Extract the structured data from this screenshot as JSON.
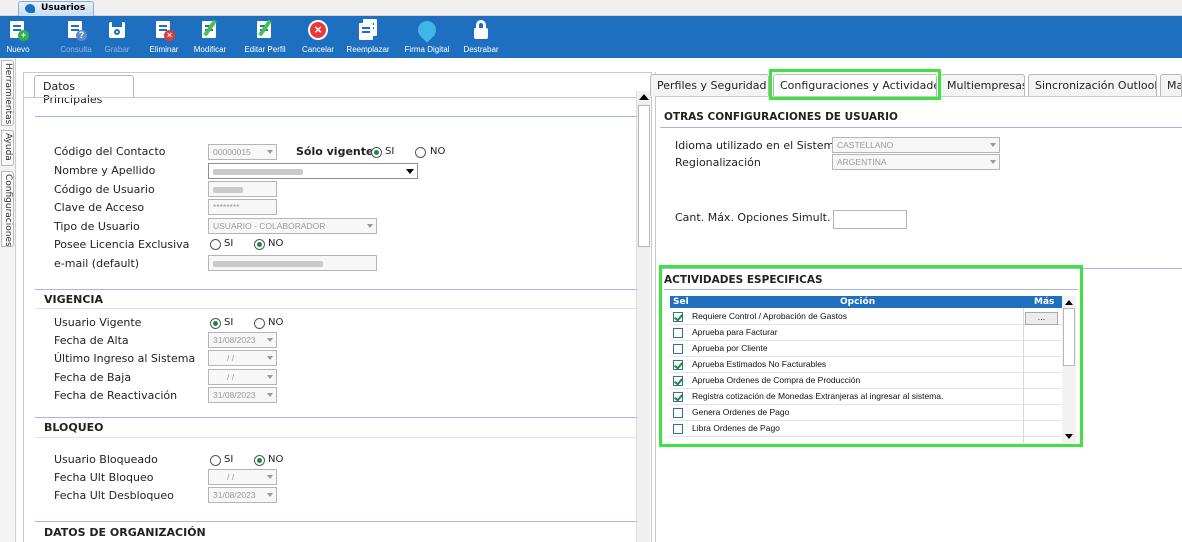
{
  "window": {
    "tab_title": "Usuarios"
  },
  "toolbar": {
    "buttons": [
      {
        "label": "Nuevo",
        "icon": "new-doc-icon",
        "enabled": true
      },
      {
        "label": "Consulta",
        "icon": "query-doc-icon",
        "enabled": false
      },
      {
        "label": "Grabar",
        "icon": "save-disk-icon",
        "enabled": false
      },
      {
        "label": "Eliminar",
        "icon": "delete-doc-icon",
        "enabled": true
      },
      {
        "label": "Modificar",
        "icon": "edit-doc-icon",
        "enabled": true
      },
      {
        "label": "Editar Perfil",
        "icon": "edit-profile-icon",
        "enabled": true
      },
      {
        "label": "Cancelar",
        "icon": "cancel-icon",
        "enabled": true
      },
      {
        "label": "Reemplazar",
        "icon": "replace-icon",
        "enabled": true
      },
      {
        "label": "Firma Digital",
        "icon": "digital-signature-icon",
        "enabled": true
      },
      {
        "label": "Destrabar",
        "icon": "unlock-icon",
        "enabled": true
      }
    ]
  },
  "side_tabs": [
    "Herramientas",
    "Ayuda",
    "Configuraciones"
  ],
  "left": {
    "tab": "Datos Principales",
    "contacto": {
      "codigo_label": "Código del Contacto",
      "codigo_value": "00000015",
      "solo_vigentes_label": "Sólo vigentes",
      "si": "SI",
      "no": "NO",
      "nombre_label": "Nombre y Apellido",
      "codigo_usuario_label": "Código de Usuario",
      "clave_label": "Clave de Acceso",
      "clave_value": "********",
      "tipo_label": "Tipo de Usuario",
      "tipo_value": "USUARIO - COLABORADOR",
      "licencia_label": "Posee Licencia Exclusiva",
      "email_label": "e-mail (default)"
    },
    "vigencia": {
      "title": "VIGENCIA",
      "usuario_vigente_label": "Usuario Vigente",
      "fecha_alta_label": "Fecha de Alta",
      "fecha_alta_value": "31/08/2023",
      "ultimo_ingreso_label": "Último Ingreso al Sistema",
      "empty_date": "/ /",
      "fecha_baja_label": "Fecha de Baja",
      "fecha_reactivacion_label": "Fecha de Reactivación",
      "fecha_reactivacion_value": "31/08/2023"
    },
    "bloqueo": {
      "title": "BLOQUEO",
      "bloqueado_label": "Usuario Bloqueado",
      "fecha_bloqueo_label": "Fecha Ult Bloqueo",
      "fecha_desbloqueo_label": "Fecha Ult Desbloqueo",
      "fecha_desbloqueo_value": "31/08/2023"
    },
    "organizacion": {
      "title": "DATOS DE ORGANIZACIÓN"
    }
  },
  "right": {
    "tabs": [
      "Perfiles y Seguridad",
      "Configuraciones y Actividades",
      "Multiempresas",
      "Sincronización Outlook",
      "Ma"
    ],
    "otras": {
      "title": "OTRAS CONFIGURACIONES DE USUARIO",
      "idioma_label": "Idioma utilizado en el Sistema",
      "idioma_value": "CASTELLANO",
      "regional_label": "Regionalización",
      "regional_value": "ARGENTINA",
      "cant_label": "Cant. Máx. Opciones Simult."
    },
    "actividades": {
      "title": "ACTIVIDADES ESPECIFICAS",
      "col_sel": "Sel",
      "col_opcion": "Opción",
      "col_mas": "Más",
      "more_button": "...",
      "rows": [
        {
          "checked": true,
          "label": "Requiere Control / Aprobación de Gastos"
        },
        {
          "checked": false,
          "label": "Aprueba para Facturar"
        },
        {
          "checked": false,
          "label": "Aprueba por Cliente"
        },
        {
          "checked": true,
          "label": "Aprueba Estimados No Facturables"
        },
        {
          "checked": true,
          "label": "Aprueba Ordenes de Compra de Producción"
        },
        {
          "checked": true,
          "label": "Registra cotización de Monedas Extranjeras al ingresar al sistema."
        },
        {
          "checked": false,
          "label": "Genera Ordenes de Pago"
        },
        {
          "checked": false,
          "label": "Libra Ordenes de Pago"
        }
      ]
    }
  },
  "colors": {
    "toolbar": "#1f6fc1",
    "highlight": "#3fe33f",
    "section_line": "#9bbbe0"
  }
}
